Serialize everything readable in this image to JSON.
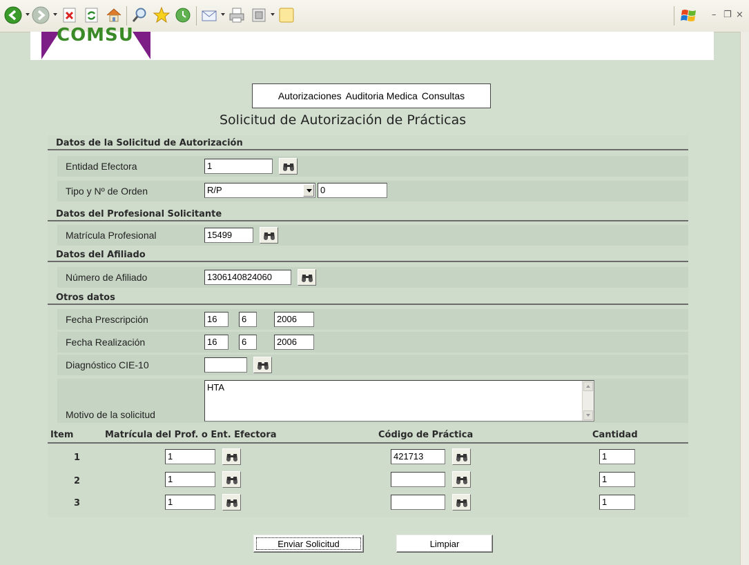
{
  "logo": {
    "text": "COMSU"
  },
  "menu": {
    "items": [
      "Autorizaciones",
      "Auditoria Medica",
      "Consultas"
    ]
  },
  "page_title": "Solicitud de Autorización de Prácticas",
  "sections": {
    "solicitud": {
      "heading": "Datos de la Solicitud de Autorización",
      "entidad_label": "Entidad Efectora",
      "entidad_value": "1",
      "tipo_label": "Tipo y Nº de Orden",
      "tipo_value": "R/P",
      "orden_value": "0"
    },
    "profesional": {
      "heading": "Datos del Profesional Solicitante",
      "matricula_label": "Matrícula Profesional",
      "matricula_value": "15499"
    },
    "afiliado": {
      "heading": "Datos del Afiliado",
      "numero_label": "Número de Afiliado",
      "numero_value": "1306140824060"
    },
    "otros": {
      "heading": "Otros datos",
      "prescripcion_label": "Fecha Prescripción",
      "prescripcion": {
        "day": "16",
        "month": "6",
        "year": "2006"
      },
      "realizacion_label": "Fecha Realización",
      "realizacion": {
        "day": "16",
        "month": "6",
        "year": "2006"
      },
      "diagnostico_label": "Diagnóstico CIE-10",
      "diagnostico_value": "",
      "motivo_label": "Motivo de la solicitud",
      "motivo_value": "HTA"
    }
  },
  "items_table": {
    "headers": [
      "Item",
      "Matrícula del Prof. o Ent. Efectora",
      "Código de Práctica",
      "Cantidad"
    ],
    "rows": [
      {
        "item": "1",
        "matricula": "1",
        "codigo": "421713",
        "cantidad": "1"
      },
      {
        "item": "2",
        "matricula": "1",
        "codigo": "",
        "cantidad": "1"
      },
      {
        "item": "3",
        "matricula": "1",
        "codigo": "",
        "cantidad": "1"
      }
    ]
  },
  "buttons": {
    "enviar": "Enviar Solicitud",
    "limpiar": "Limpiar"
  },
  "colors": {
    "page_bg": "#d2dfcf",
    "panel_bg": "#cfdccc",
    "logo_purple": "#7c1e86",
    "logo_green": "#3b8a28"
  },
  "toolbar_icons": [
    "back-icon",
    "forward-icon",
    "stop-icon",
    "refresh-icon",
    "home-icon",
    "search-icon",
    "favorites-icon",
    "history-icon",
    "mail-icon",
    "print-icon",
    "edit-icon",
    "notes-icon",
    "windows-logo-icon"
  ]
}
